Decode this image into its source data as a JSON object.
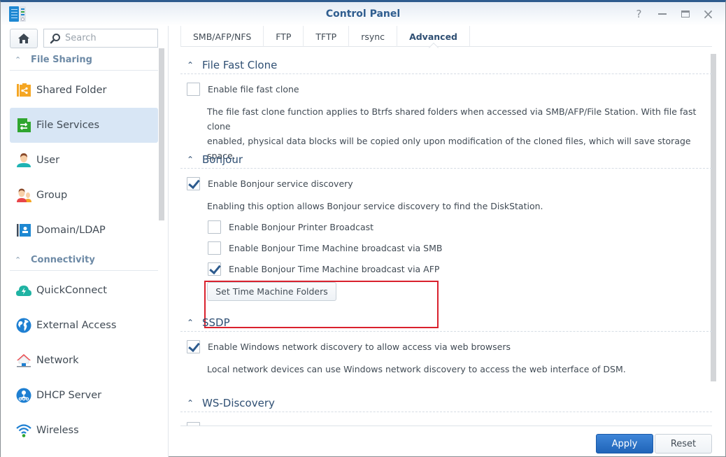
{
  "window": {
    "title": "Control Panel",
    "controls": {
      "help": "?",
      "minimize": "minimize",
      "maximize": "maximize",
      "close": "×"
    }
  },
  "sidebar": {
    "search_placeholder": "Search",
    "groups": [
      {
        "label": "File Sharing",
        "items": [
          {
            "label": "Shared Folder",
            "icon": "shared-folder-icon",
            "active": false
          },
          {
            "label": "File Services",
            "icon": "file-services-icon",
            "active": true
          },
          {
            "label": "User",
            "icon": "user-icon",
            "active": false
          },
          {
            "label": "Group",
            "icon": "group-icon",
            "active": false
          },
          {
            "label": "Domain/LDAP",
            "icon": "domain-ldap-icon",
            "active": false
          }
        ]
      },
      {
        "label": "Connectivity",
        "items": [
          {
            "label": "QuickConnect",
            "icon": "quickconnect-icon",
            "active": false
          },
          {
            "label": "External Access",
            "icon": "globe-icon",
            "active": false
          },
          {
            "label": "Network",
            "icon": "network-house-icon",
            "active": false
          },
          {
            "label": "DHCP Server",
            "icon": "dhcp-server-icon",
            "active": false
          },
          {
            "label": "Wireless",
            "icon": "wifi-icon",
            "active": false
          }
        ]
      }
    ]
  },
  "tabs": [
    {
      "label": "SMB/AFP/NFS",
      "active": false
    },
    {
      "label": "FTP",
      "active": false
    },
    {
      "label": "TFTP",
      "active": false
    },
    {
      "label": "rsync",
      "active": false
    },
    {
      "label": "Advanced",
      "active": true
    }
  ],
  "sections": {
    "file_fast_clone": {
      "title": "File Fast Clone",
      "enable_label": "Enable file fast clone",
      "enable_checked": false,
      "description_line1": "The file fast clone function applies to Btrfs shared folders when accessed via SMB/AFP/File Station. With file fast clone",
      "description_line2": "enabled, physical data blocks will be copied only upon modification of the cloned files, which will save storage space."
    },
    "bonjour": {
      "title": "Bonjour",
      "enable_label": "Enable Bonjour service discovery",
      "enable_checked": true,
      "description": "Enabling this option allows Bonjour service discovery to find the DiskStation.",
      "printer_label": "Enable Bonjour Printer Broadcast",
      "printer_checked": false,
      "tm_smb_label": "Enable Bonjour Time Machine broadcast via SMB",
      "tm_smb_checked": false,
      "tm_afp_label": "Enable Bonjour Time Machine broadcast via AFP",
      "tm_afp_checked": true,
      "tm_folders_button": "Set Time Machine Folders"
    },
    "ssdp": {
      "title": "SSDP",
      "enable_label": "Enable Windows network discovery to allow access via web browsers",
      "enable_checked": true,
      "description": "Local network devices can use Windows network discovery to access the web interface of DSM."
    },
    "ws_discovery": {
      "title": "WS-Discovery"
    }
  },
  "footer": {
    "apply_label": "Apply",
    "reset_label": "Reset"
  },
  "colors": {
    "accent": "#2d5b8e",
    "apply_button": "#2a72c8",
    "active_nav_bg": "#d8e6f5",
    "highlight_box": "#d9212d"
  }
}
